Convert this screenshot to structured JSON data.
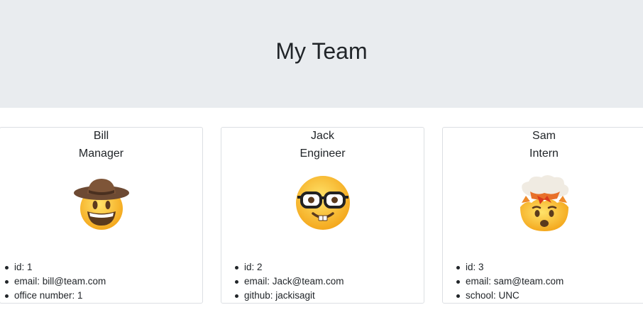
{
  "header": {
    "title": "My Team"
  },
  "employees": [
    {
      "name": "Bill",
      "role": "Manager",
      "icon": "cowboy-face-icon",
      "details": [
        "id: 1",
        "email: bill@team.com",
        "office number: 1"
      ]
    },
    {
      "name": "Jack",
      "role": "Engineer",
      "icon": "nerd-face-icon",
      "details": [
        "id: 2",
        "email: Jack@team.com",
        "github: jackisagit"
      ]
    },
    {
      "name": "Sam",
      "role": "Intern",
      "icon": "exploding-head-icon",
      "details": [
        "id: 3",
        "email: sam@team.com",
        "school: UNC"
      ]
    }
  ],
  "colors": {
    "header_bg": "#e9ecef",
    "text": "#212529",
    "card_border": "#dcdfe3",
    "emoji_yellow": "#f7c12b"
  }
}
